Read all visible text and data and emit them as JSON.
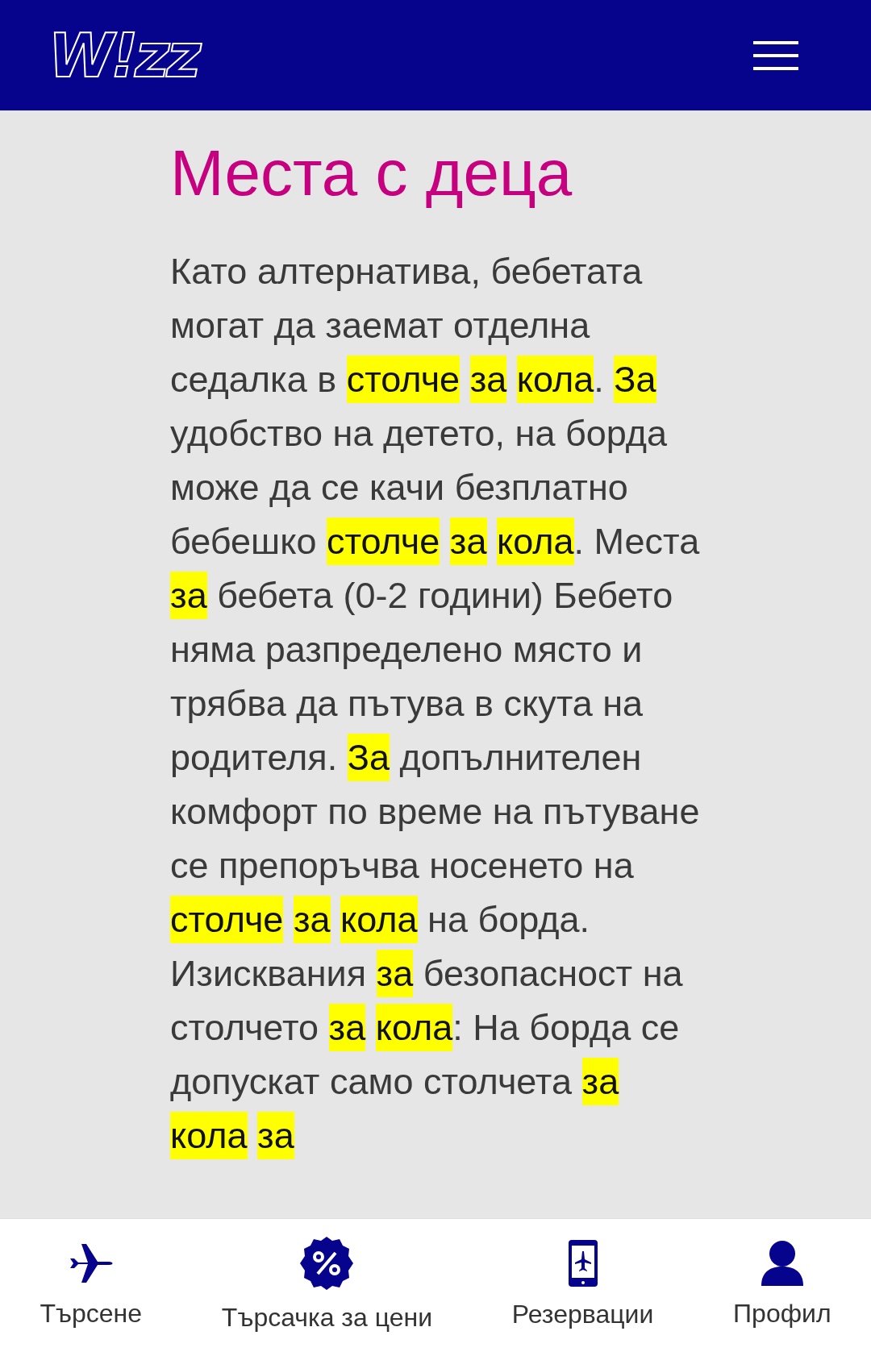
{
  "header": {
    "logo": "W!zz"
  },
  "article": {
    "title": "Места с деца",
    "segments": [
      {
        "text": "Като алтернатива, бебетата могат да заемат отделна седалка в ",
        "highlighted": false
      },
      {
        "text": "столче ",
        "highlighted": true
      },
      {
        "text": "за ",
        "highlighted": true
      },
      {
        "text": "кола",
        "highlighted": true
      },
      {
        "text": ". ",
        "highlighted": false
      },
      {
        "text": "За",
        "highlighted": true
      },
      {
        "text": " удобство на детето, на борда може да се качи безплатно бебешко ",
        "highlighted": false
      },
      {
        "text": "столче ",
        "highlighted": true
      },
      {
        "text": "за ",
        "highlighted": true
      },
      {
        "text": "кола",
        "highlighted": true
      },
      {
        "text": ". Места ",
        "highlighted": false
      },
      {
        "text": "за",
        "highlighted": true
      },
      {
        "text": " бебета (0-2 години) Бебето няма разпределено място и трябва да пътува в скута на родителя. ",
        "highlighted": false
      },
      {
        "text": "За",
        "highlighted": true
      },
      {
        "text": " допълнителен комфорт по време на пътуване се препоръчва носенето на ",
        "highlighted": false
      },
      {
        "text": "столче ",
        "highlighted": true
      },
      {
        "text": "за ",
        "highlighted": true
      },
      {
        "text": "кола",
        "highlighted": true
      },
      {
        "text": " на борда. Изисквания ",
        "highlighted": false
      },
      {
        "text": "за",
        "highlighted": true
      },
      {
        "text": " безопасност на столчето ",
        "highlighted": false
      },
      {
        "text": "за ",
        "highlighted": true
      },
      {
        "text": "кола",
        "highlighted": true
      },
      {
        "text": ": На борда се допускат само столчета ",
        "highlighted": false
      },
      {
        "text": "за ",
        "highlighted": true
      },
      {
        "text": "кола ",
        "highlighted": true
      },
      {
        "text": "за",
        "highlighted": true
      }
    ]
  },
  "bottom_nav": [
    {
      "label": "Търсене"
    },
    {
      "label": "Търсачка за цени"
    },
    {
      "label": "Резервации"
    },
    {
      "label": "Профил"
    }
  ]
}
